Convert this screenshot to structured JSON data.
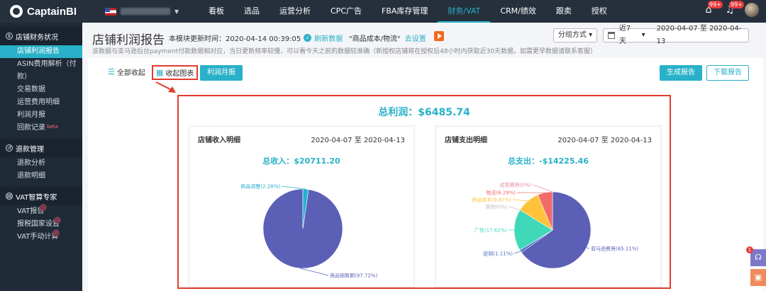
{
  "brand": "CaptainBI",
  "nav": [
    "看板",
    "选品",
    "运营分析",
    "CPC广告",
    "FBA库存管理",
    "财务/VAT",
    "CRM/绩效",
    "跟卖",
    "授权"
  ],
  "nav_active": 5,
  "badges": {
    "gift": "99+",
    "bell": "99+"
  },
  "sidebar": {
    "sections": [
      {
        "title": "店铺财务状况",
        "items": [
          "店铺利润报告",
          "ASIN费用解析（付",
          "款）",
          "交易数据",
          "运营费用明细",
          "利润月报",
          "回款记录"
        ]
      },
      {
        "title": "退款管理",
        "items": [
          "退款分析",
          "退款明细"
        ]
      },
      {
        "title": "VAT智算专家",
        "items": [
          "VAT报告",
          "报税国家设置",
          "VAT手动计算"
        ]
      }
    ],
    "beta": "beta"
  },
  "header": {
    "title": "店铺利润报告",
    "updated": "本模块更新时间：2020-04-14 00:39:05",
    "refresh": "刷新数据",
    "cost_label": "\"商品成本/物流\"",
    "cost_link": "去设置",
    "note": "该数据与亚马逊后台payment付款数据相对应，当日更新频率较慢，可以看今天之前的数据较准确（新授权店铺将在授权后48小时内获取近30天数据，如需更早数据请联系客服）",
    "groupby": "分组方式",
    "range": "近7天",
    "dates": "2020-04-07 至 2020-04-13"
  },
  "toolbar": {
    "collapse_all": "全部收起",
    "collapse_chart": "收起图表",
    "monthly": "利润月报",
    "generate": "生成报告",
    "download": "下载报告"
  },
  "total_profit": "总利润：$6485.74",
  "income": {
    "title": "店铺收入明细",
    "dates": "2020-04-07 至 2020-04-13",
    "total": "总收入：$20711.20"
  },
  "expense": {
    "title": "店铺支出明细",
    "dates": "2020-04-07 至 2020-04-13",
    "total": "总支出：-$14225.46"
  },
  "chart_data": [
    {
      "type": "pie",
      "categories": [
        "商品销售额",
        "商品调整"
      ],
      "values": [
        97.72,
        2.28
      ],
      "colors": [
        "#5b5fb6",
        "#26b0d0"
      ],
      "labels": [
        "商品销售额(97.72%)",
        "商品调整(2.28%)"
      ]
    },
    {
      "type": "pie",
      "categories": [
        "亚马逊费用",
        "促销",
        "广告",
        "其他",
        "商品成本",
        "物流",
        "运营费用"
      ],
      "values": [
        65.11,
        1.11,
        17.62,
        0,
        9.87,
        6.29,
        0
      ],
      "colors": [
        "#5b5fb6",
        "#4a6fc2",
        "#3fd8b8",
        "#bcbcbc",
        "#ffc23a",
        "#f26b6b",
        "#e88aa0"
      ],
      "labels": [
        "亚马逊费用(65.11%)",
        "促销(1.11%)",
        "广告(17.62%)",
        "其他(0%)",
        "商品成本(9.87%)",
        "物流(6.29%)",
        "运营费用(0%)"
      ]
    }
  ]
}
